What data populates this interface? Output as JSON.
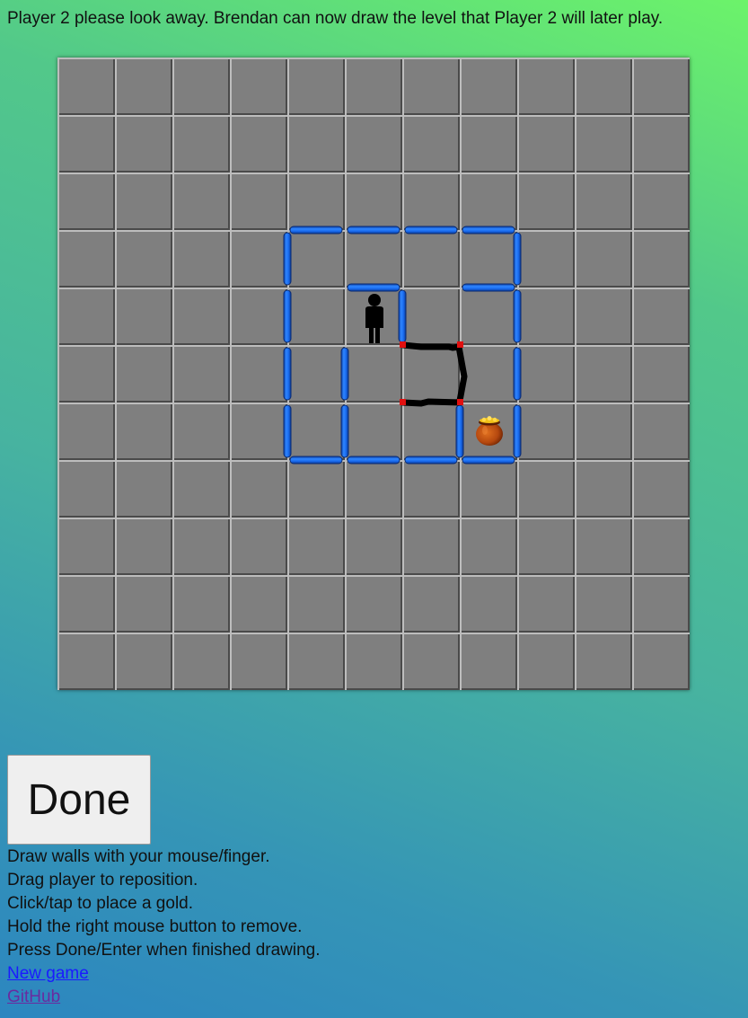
{
  "header": {
    "instruction": "Player 2 please look away. Brendan can now draw the level that Player 2 will later play."
  },
  "board": {
    "cols": 11,
    "rows": 11,
    "tile_color": "#7f7f7f",
    "wall_color": "#1565e0",
    "drawn_stroke_color": "#000000",
    "anchor_color": "#e01010",
    "player_icon": "person-silhouette-icon",
    "gold_icon": "pot-of-gold-icon",
    "player_cell": [
      5,
      4
    ],
    "gold_cell": [
      7,
      6
    ],
    "walls_horizontal": [
      [
        3,
        4
      ],
      [
        3,
        5
      ],
      [
        3,
        6
      ],
      [
        3,
        7
      ],
      [
        4,
        5
      ],
      [
        4,
        7
      ],
      [
        7,
        4
      ],
      [
        7,
        5
      ],
      [
        7,
        6
      ],
      [
        7,
        7
      ]
    ],
    "walls_vertical": [
      [
        3,
        4
      ],
      [
        3,
        8
      ],
      [
        4,
        4
      ],
      [
        4,
        6
      ],
      [
        4,
        8
      ],
      [
        5,
        4
      ],
      [
        5,
        5
      ],
      [
        5,
        8
      ],
      [
        6,
        4
      ],
      [
        6,
        5
      ],
      [
        6,
        7
      ],
      [
        6,
        8
      ]
    ]
  },
  "controls": {
    "done_label": "Done"
  },
  "help": {
    "lines": [
      "Draw walls with your mouse/finger.",
      "Drag player to reposition.",
      "Click/tap to place a gold.",
      "Hold the right mouse button to remove.",
      "Press Done/Enter when finished drawing."
    ],
    "new_game": "New game",
    "github": "GitHub"
  }
}
